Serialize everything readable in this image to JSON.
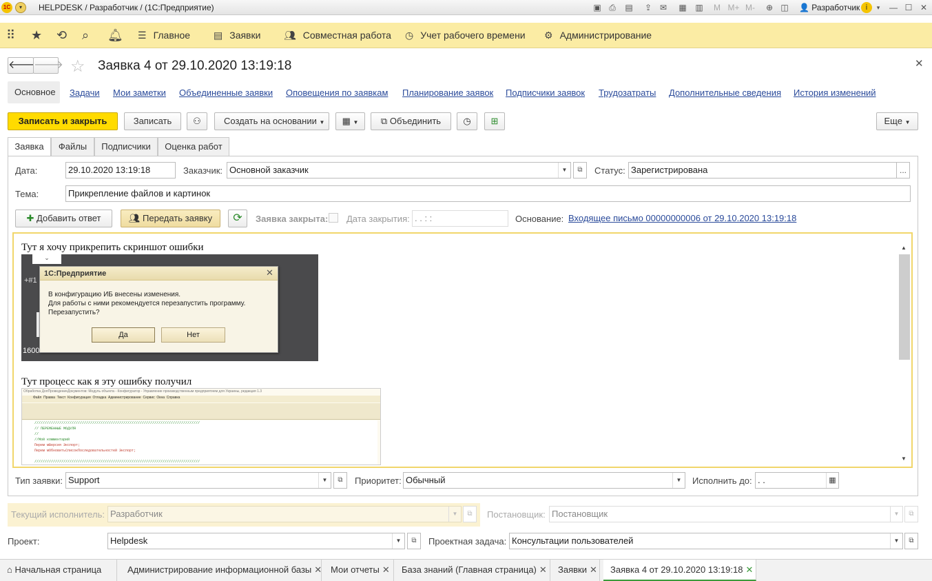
{
  "window": {
    "title": "HELPDESK / Разработчик /  (1С:Предприятие)",
    "user": "Разработчик",
    "calc_btns": [
      "M",
      "M+",
      "M-"
    ]
  },
  "nav": {
    "main": "Главное",
    "requests": "Заявки",
    "collab": "Совместная работа",
    "time": "Учет рабочего времени",
    "admin": "Администрирование"
  },
  "doc": {
    "title": "Заявка 4 от 29.10.2020 13:19:18"
  },
  "sections": [
    "Основное",
    "Задачи",
    "Мои заметки",
    "Объединенные заявки",
    "Оповещения по заявкам",
    "Планирование заявок",
    "Подписчики заявок",
    "Трудозатраты",
    "Дополнительные сведения",
    "История изменений"
  ],
  "toolbar": {
    "save_close": "Записать и закрыть",
    "save": "Записать",
    "create_based": "Создать на основании",
    "merge": "Объединить",
    "more": "Еще"
  },
  "tabs": [
    "Заявка",
    "Файлы",
    "Подписчики",
    "Оценка работ"
  ],
  "form": {
    "date_label": "Дата:",
    "date": "29.10.2020 13:19:18",
    "customer_label": "Заказчик:",
    "customer": "Основной заказчик",
    "status_label": "Статус:",
    "status": "Зарегистрирована",
    "status_btn": "...",
    "topic_label": "Тема:",
    "topic": "Прикрепление файлов и картинок",
    "add_answer": "Добавить ответ",
    "transfer": "Передать заявку",
    "closed_label": "Заявка закрыта:",
    "close_date_label": "Дата закрытия:",
    "close_date": " .  .       :  :",
    "basis_label": "Основание:",
    "basis": "Входящее письмо 00000000006 от 29.10.2020 13:19:18",
    "type_label": "Тип заявки:",
    "type": "Support",
    "priority_label": "Приоритет:",
    "priority": "Обычный",
    "due_label": "Исполнить до:",
    "due": " .  .",
    "executor_label": "Текущий исполнитель:",
    "executor": "Разработчик",
    "setter_label": "Постановщик:",
    "setter": "Постановщик",
    "project_label": "Проект:",
    "project": "Helpdesk",
    "ptask_label": "Проектная задача:",
    "ptask": "Консультации пользователей"
  },
  "content": {
    "p1": "Тут я хочу прикрепить скриншот ошибки",
    "p2": "Тут процесс как я эту ошибку получил",
    "shot1_prefix": "+#1",
    "shot1_footer": "1600...",
    "dialog": {
      "title": "1С:Предприятие",
      "line1": "В конфигурацию ИБ внесены изменения.",
      "line2": "Для работы с ними рекомендуется перезапустить программу.",
      "line3": "Перезапустить?",
      "yes": "Да",
      "no": "Нет"
    },
    "shot2": {
      "title": "Обработка ДопПроведениеДокументов: Модуль объекта - Конфигуратор - Управление производственным предприятием для Украины, редакция 1.3",
      "menu": [
        "Файл",
        "Правка",
        "Текст",
        "Конфигурация",
        "Отладка",
        "Администрирование",
        "Сервис",
        "Окна",
        "Справка"
      ],
      "code": [
        "////////////////////////////////////////////////////////////////////////////////",
        "// ПЕРЕМЕННЫЕ МОДУЛЯ",
        "//",
        "//Мой комментарий",
        "Перем мВерсия Экспорт;",
        "Перем мОбновитьСписокПоследовательностей Экспорт;",
        "",
        "////////////////////////////////////////////////////////////////////////////////"
      ]
    }
  },
  "bottom_tabs": [
    "Начальная страница",
    "Администрирование информационной базы",
    "Мои отчеты",
    "База знаний (Главная страница)",
    "Заявки",
    "Заявка 4 от 29.10.2020 13:19:18"
  ]
}
